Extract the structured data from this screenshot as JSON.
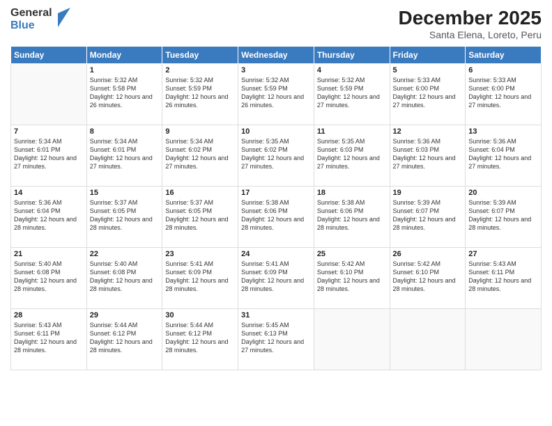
{
  "logo": {
    "general": "General",
    "blue": "Blue"
  },
  "header": {
    "month": "December 2025",
    "location": "Santa Elena, Loreto, Peru"
  },
  "days_of_week": [
    "Sunday",
    "Monday",
    "Tuesday",
    "Wednesday",
    "Thursday",
    "Friday",
    "Saturday"
  ],
  "weeks": [
    [
      {
        "day": "",
        "sunrise": "",
        "sunset": "",
        "daylight": ""
      },
      {
        "day": "1",
        "sunrise": "Sunrise: 5:32 AM",
        "sunset": "Sunset: 5:58 PM",
        "daylight": "Daylight: 12 hours and 26 minutes."
      },
      {
        "day": "2",
        "sunrise": "Sunrise: 5:32 AM",
        "sunset": "Sunset: 5:59 PM",
        "daylight": "Daylight: 12 hours and 26 minutes."
      },
      {
        "day": "3",
        "sunrise": "Sunrise: 5:32 AM",
        "sunset": "Sunset: 5:59 PM",
        "daylight": "Daylight: 12 hours and 26 minutes."
      },
      {
        "day": "4",
        "sunrise": "Sunrise: 5:32 AM",
        "sunset": "Sunset: 5:59 PM",
        "daylight": "Daylight: 12 hours and 27 minutes."
      },
      {
        "day": "5",
        "sunrise": "Sunrise: 5:33 AM",
        "sunset": "Sunset: 6:00 PM",
        "daylight": "Daylight: 12 hours and 27 minutes."
      },
      {
        "day": "6",
        "sunrise": "Sunrise: 5:33 AM",
        "sunset": "Sunset: 6:00 PM",
        "daylight": "Daylight: 12 hours and 27 minutes."
      }
    ],
    [
      {
        "day": "7",
        "sunrise": "Sunrise: 5:34 AM",
        "sunset": "Sunset: 6:01 PM",
        "daylight": "Daylight: 12 hours and 27 minutes."
      },
      {
        "day": "8",
        "sunrise": "Sunrise: 5:34 AM",
        "sunset": "Sunset: 6:01 PM",
        "daylight": "Daylight: 12 hours and 27 minutes."
      },
      {
        "day": "9",
        "sunrise": "Sunrise: 5:34 AM",
        "sunset": "Sunset: 6:02 PM",
        "daylight": "Daylight: 12 hours and 27 minutes."
      },
      {
        "day": "10",
        "sunrise": "Sunrise: 5:35 AM",
        "sunset": "Sunset: 6:02 PM",
        "daylight": "Daylight: 12 hours and 27 minutes."
      },
      {
        "day": "11",
        "sunrise": "Sunrise: 5:35 AM",
        "sunset": "Sunset: 6:03 PM",
        "daylight": "Daylight: 12 hours and 27 minutes."
      },
      {
        "day": "12",
        "sunrise": "Sunrise: 5:36 AM",
        "sunset": "Sunset: 6:03 PM",
        "daylight": "Daylight: 12 hours and 27 minutes."
      },
      {
        "day": "13",
        "sunrise": "Sunrise: 5:36 AM",
        "sunset": "Sunset: 6:04 PM",
        "daylight": "Daylight: 12 hours and 27 minutes."
      }
    ],
    [
      {
        "day": "14",
        "sunrise": "Sunrise: 5:36 AM",
        "sunset": "Sunset: 6:04 PM",
        "daylight": "Daylight: 12 hours and 28 minutes."
      },
      {
        "day": "15",
        "sunrise": "Sunrise: 5:37 AM",
        "sunset": "Sunset: 6:05 PM",
        "daylight": "Daylight: 12 hours and 28 minutes."
      },
      {
        "day": "16",
        "sunrise": "Sunrise: 5:37 AM",
        "sunset": "Sunset: 6:05 PM",
        "daylight": "Daylight: 12 hours and 28 minutes."
      },
      {
        "day": "17",
        "sunrise": "Sunrise: 5:38 AM",
        "sunset": "Sunset: 6:06 PM",
        "daylight": "Daylight: 12 hours and 28 minutes."
      },
      {
        "day": "18",
        "sunrise": "Sunrise: 5:38 AM",
        "sunset": "Sunset: 6:06 PM",
        "daylight": "Daylight: 12 hours and 28 minutes."
      },
      {
        "day": "19",
        "sunrise": "Sunrise: 5:39 AM",
        "sunset": "Sunset: 6:07 PM",
        "daylight": "Daylight: 12 hours and 28 minutes."
      },
      {
        "day": "20",
        "sunrise": "Sunrise: 5:39 AM",
        "sunset": "Sunset: 6:07 PM",
        "daylight": "Daylight: 12 hours and 28 minutes."
      }
    ],
    [
      {
        "day": "21",
        "sunrise": "Sunrise: 5:40 AM",
        "sunset": "Sunset: 6:08 PM",
        "daylight": "Daylight: 12 hours and 28 minutes."
      },
      {
        "day": "22",
        "sunrise": "Sunrise: 5:40 AM",
        "sunset": "Sunset: 6:08 PM",
        "daylight": "Daylight: 12 hours and 28 minutes."
      },
      {
        "day": "23",
        "sunrise": "Sunrise: 5:41 AM",
        "sunset": "Sunset: 6:09 PM",
        "daylight": "Daylight: 12 hours and 28 minutes."
      },
      {
        "day": "24",
        "sunrise": "Sunrise: 5:41 AM",
        "sunset": "Sunset: 6:09 PM",
        "daylight": "Daylight: 12 hours and 28 minutes."
      },
      {
        "day": "25",
        "sunrise": "Sunrise: 5:42 AM",
        "sunset": "Sunset: 6:10 PM",
        "daylight": "Daylight: 12 hours and 28 minutes."
      },
      {
        "day": "26",
        "sunrise": "Sunrise: 5:42 AM",
        "sunset": "Sunset: 6:10 PM",
        "daylight": "Daylight: 12 hours and 28 minutes."
      },
      {
        "day": "27",
        "sunrise": "Sunrise: 5:43 AM",
        "sunset": "Sunset: 6:11 PM",
        "daylight": "Daylight: 12 hours and 28 minutes."
      }
    ],
    [
      {
        "day": "28",
        "sunrise": "Sunrise: 5:43 AM",
        "sunset": "Sunset: 6:11 PM",
        "daylight": "Daylight: 12 hours and 28 minutes."
      },
      {
        "day": "29",
        "sunrise": "Sunrise: 5:44 AM",
        "sunset": "Sunset: 6:12 PM",
        "daylight": "Daylight: 12 hours and 28 minutes."
      },
      {
        "day": "30",
        "sunrise": "Sunrise: 5:44 AM",
        "sunset": "Sunset: 6:12 PM",
        "daylight": "Daylight: 12 hours and 28 minutes."
      },
      {
        "day": "31",
        "sunrise": "Sunrise: 5:45 AM",
        "sunset": "Sunset: 6:13 PM",
        "daylight": "Daylight: 12 hours and 27 minutes."
      },
      {
        "day": "",
        "sunrise": "",
        "sunset": "",
        "daylight": ""
      },
      {
        "day": "",
        "sunrise": "",
        "sunset": "",
        "daylight": ""
      },
      {
        "day": "",
        "sunrise": "",
        "sunset": "",
        "daylight": ""
      }
    ]
  ]
}
